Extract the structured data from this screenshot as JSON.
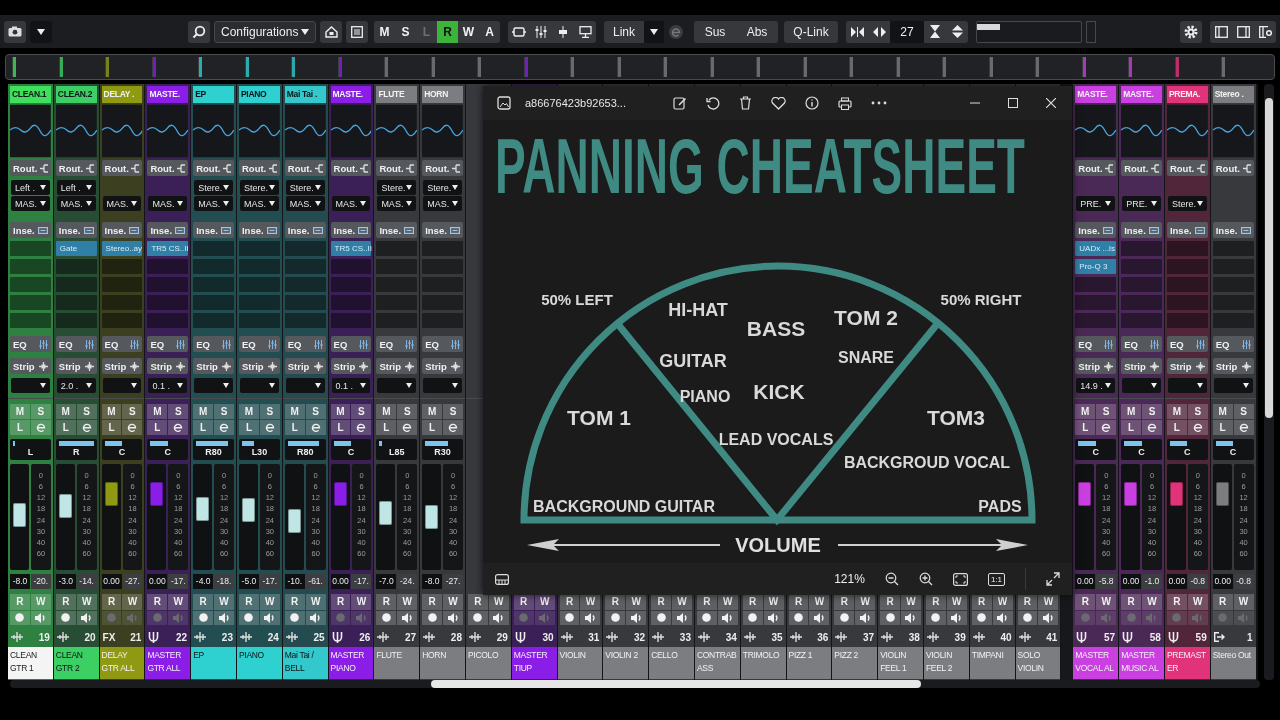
{
  "toolbar": {
    "configurations": "Configurations",
    "modes": [
      {
        "label": "M",
        "on": false,
        "disabled": false
      },
      {
        "label": "S",
        "on": false,
        "disabled": false
      },
      {
        "label": "L",
        "on": false,
        "disabled": true
      },
      {
        "label": "R",
        "on": true,
        "disabled": false
      },
      {
        "label": "W",
        "on": false,
        "disabled": false
      },
      {
        "label": "A",
        "on": false,
        "disabled": false
      }
    ],
    "link": "Link",
    "sus": "Sus",
    "abs": "Abs",
    "qlink": "Q-Link",
    "value": "27",
    "meter": {
      "level": 0.22
    }
  },
  "channels": [
    {
      "header": "CLEAN.1",
      "color": "#3ee05c",
      "selected": true,
      "kind": "audio",
      "rout": "Rout.",
      "input": "Left .",
      "output": "MAS.",
      "ins": "Inse.",
      "eq": "EQ",
      "strip": "Strip",
      "buttons": [
        "M",
        "S",
        "L"
      ],
      "pan": {
        "label": "L",
        "level": 0
      },
      "scale": [
        "0",
        "6",
        "12",
        "18",
        "24",
        "30",
        "40",
        "60"
      ],
      "fader": {
        "level": 0.52
      },
      "volume": "-8.0",
      "peak": "-20.",
      "rw": [
        "R",
        "W"
      ],
      "rec_enabled": true,
      "number": "19",
      "name": "CLEAN GTR 1"
    },
    {
      "header": "CLEAN.2",
      "color": "#3ccf64",
      "selected": false,
      "kind": "audio",
      "rout": "Rout.",
      "input": "Left .",
      "output": "MAS.",
      "ins": "Inse.",
      "inserts": [
        "Gate"
      ],
      "eq": "EQ",
      "strip": "Strip",
      "strip_value": "2.0 .",
      "buttons": [
        "M",
        "S",
        "L"
      ],
      "pan": {
        "label": "R",
        "level": 1
      },
      "scale": [
        "0",
        "6",
        "12",
        "18",
        "24",
        "30",
        "40",
        "60"
      ],
      "fader": {
        "level": 0.64
      },
      "volume": "-3.0",
      "peak": "-14.",
      "rw": [
        "R",
        "W"
      ],
      "rec_enabled": true,
      "number": "20",
      "name": "CLEAN GTR 2"
    },
    {
      "header": "DELAY .",
      "color": "#8f9a12",
      "selected": false,
      "kind": "fx",
      "type_label": "FX",
      "rout": "Rout.",
      "output": "MAS.",
      "ins": "Inse.",
      "inserts": [
        "Stereo..ay"
      ],
      "eq": "EQ",
      "strip": "Strip",
      "buttons": [
        "M",
        "S",
        "L"
      ],
      "pan": {
        "label": "C",
        "level": 0.5
      },
      "scale": [
        "0",
        "6",
        "12",
        "18",
        "24",
        "30",
        "40",
        "60"
      ],
      "fader": {
        "level": 0.78
      },
      "volume": "0.00",
      "peak": "-27.",
      "rw": [
        "R",
        "W"
      ],
      "rec_enabled": false,
      "number": "21",
      "name": "DELAY GTR ALL"
    },
    {
      "header": "MASTE.",
      "color": "#8a1ee6",
      "selected": false,
      "kind": "group",
      "rout": "Rout.",
      "output": "MAS.",
      "ins": "Inse.",
      "inserts": [
        "TR5 CS..II"
      ],
      "eq": "EQ",
      "strip": "Strip",
      "strip_value": "0.1 .",
      "buttons": [
        "M",
        "S",
        "L"
      ],
      "pan": {
        "label": "C",
        "level": 0.5
      },
      "scale": [
        "0",
        "6",
        "12",
        "18",
        "24",
        "30",
        "40",
        "60"
      ],
      "fader": {
        "level": 0.78
      },
      "volume": "0.00",
      "peak": "-17.",
      "rw": [
        "R",
        "W"
      ],
      "rec_enabled": false,
      "number": "22",
      "name": "MASTER GTR ALL"
    },
    {
      "header": "EP",
      "color": "#2ed0d0",
      "selected": false,
      "kind": "audio",
      "rout": "Rout.",
      "input": "Stere.",
      "output": "MAS.",
      "ins": "Inse.",
      "eq": "EQ",
      "strip": "Strip",
      "buttons": [
        "M",
        "S",
        "L"
      ],
      "pan": {
        "label": "R80",
        "level": 0.9
      },
      "scale": [
        "0",
        "6",
        "12",
        "18",
        "24",
        "30",
        "40",
        "60"
      ],
      "fader": {
        "level": 0.6
      },
      "volume": "-4.0",
      "peak": "-18.",
      "rw": [
        "R",
        "W"
      ],
      "rec_enabled": true,
      "number": "23",
      "name": "EP"
    },
    {
      "header": "PIANO",
      "color": "#2ed0d0",
      "selected": false,
      "kind": "audio",
      "rout": "Rout.",
      "input": "Stere.",
      "output": "MAS.",
      "ins": "Inse.",
      "eq": "EQ",
      "strip": "Strip",
      "buttons": [
        "M",
        "S",
        "L"
      ],
      "pan": {
        "label": "L30",
        "level": 0.35
      },
      "scale": [
        "0",
        "6",
        "12",
        "18",
        "24",
        "30",
        "40",
        "60"
      ],
      "fader": {
        "level": 0.58
      },
      "volume": "-5.0",
      "peak": "-17.",
      "rw": [
        "R",
        "W"
      ],
      "rec_enabled": true,
      "number": "24",
      "name": "PIANO"
    },
    {
      "header": "Mai Tai .",
      "color": "#32c8cc",
      "selected": false,
      "kind": "audio",
      "rout": "Rout.",
      "input": "Stere.",
      "output": "MAS.",
      "ins": "Inse.",
      "eq": "EQ",
      "strip": "Strip",
      "buttons": [
        "M",
        "S",
        "L"
      ],
      "pan": {
        "label": "R80",
        "level": 0.9
      },
      "scale": [
        "0",
        "6",
        "12",
        "18",
        "24",
        "30",
        "40",
        "60"
      ],
      "fader": {
        "level": 0.45
      },
      "volume": "-10.",
      "peak": "-61.",
      "rw": [
        "R",
        "W"
      ],
      "rec_enabled": true,
      "number": "25",
      "name": "Mai Tai / BELL"
    },
    {
      "header": "MASTE.",
      "color": "#8a1ee6",
      "selected": false,
      "kind": "group",
      "rout": "Rout.",
      "output": "MAS.",
      "ins": "Inse.",
      "inserts": [
        "TR5 CS..II"
      ],
      "eq": "EQ",
      "strip": "Strip",
      "strip_value": "0.1 .",
      "buttons": [
        "M",
        "S",
        "L"
      ],
      "pan": {
        "label": "C",
        "level": 0.5
      },
      "scale": [
        "0",
        "6",
        "12",
        "18",
        "24",
        "30",
        "40",
        "60"
      ],
      "fader": {
        "level": 0.78
      },
      "volume": "0.00",
      "peak": "-17.",
      "rw": [
        "R",
        "W"
      ],
      "rec_enabled": false,
      "number": "26",
      "name": "MASTER PIANO"
    },
    {
      "header": "FLUTE",
      "color": "#7b7d80",
      "selected": false,
      "kind": "audio",
      "rout": "Rout.",
      "input": "Stere.",
      "output": "MAS.",
      "ins": "Inse.",
      "eq": "EQ",
      "strip": "Strip",
      "buttons": [
        "M",
        "S",
        "L"
      ],
      "pan": {
        "label": "L85",
        "level": 0.08
      },
      "scale": [
        "0",
        "6",
        "12",
        "18",
        "24",
        "30",
        "40",
        "60"
      ],
      "fader": {
        "level": 0.55
      },
      "volume": "-7.0",
      "peak": "-24.",
      "rw": [
        "R",
        "W"
      ],
      "rec_enabled": true,
      "number": "27",
      "name": "FLUTE"
    },
    {
      "header": "HORN",
      "color": "#7b7d80",
      "selected": false,
      "kind": "audio",
      "rout": "Rout.",
      "input": "Stere.",
      "output": "MAS.",
      "ins": "Inse.",
      "eq": "EQ",
      "strip": "Strip",
      "buttons": [
        "M",
        "S",
        "L"
      ],
      "pan": {
        "label": "R30",
        "level": 0.65
      },
      "scale": [
        "0",
        "6",
        "12",
        "18",
        "24",
        "30",
        "40",
        "60"
      ],
      "fader": {
        "level": 0.5
      },
      "volume": "-8.0",
      "peak": "-27.",
      "rw": [
        "R",
        "W"
      ],
      "rec_enabled": true,
      "number": "28",
      "name": "HORN"
    },
    {
      "color": "#7b7d80",
      "selected": false,
      "kind": "audio",
      "rw": [
        "R",
        "W"
      ],
      "rec_enabled": true,
      "number": "29",
      "name": "PICOLO"
    },
    {
      "color": "#8a1ee6",
      "selected": false,
      "kind": "group",
      "rw": [
        "R",
        "W"
      ],
      "rec_enabled": false,
      "number": "30",
      "name": "MASTER TIUP"
    },
    {
      "color": "#7b7d80",
      "selected": false,
      "kind": "audio",
      "rw": [
        "R",
        "W"
      ],
      "rec_enabled": true,
      "number": "31",
      "name": "VIOLIN"
    },
    {
      "color": "#7b7d80",
      "selected": false,
      "kind": "audio",
      "rw": [
        "R",
        "W"
      ],
      "rec_enabled": true,
      "number": "32",
      "name": "VIOLIN 2"
    },
    {
      "color": "#7b7d80",
      "selected": false,
      "kind": "audio",
      "rw": [
        "R",
        "W"
      ],
      "rec_enabled": true,
      "number": "33",
      "name": "CELLO"
    },
    {
      "color": "#7b7d80",
      "selected": false,
      "kind": "audio",
      "rw": [
        "R",
        "W"
      ],
      "rec_enabled": true,
      "number": "34",
      "name": "CONTRABASS"
    },
    {
      "color": "#7b7d80",
      "selected": false,
      "kind": "audio",
      "rw": [
        "R",
        "W"
      ],
      "rec_enabled": true,
      "number": "35",
      "name": "TRIMOLO"
    },
    {
      "color": "#7b7d80",
      "selected": false,
      "kind": "audio",
      "rw": [
        "R",
        "W"
      ],
      "rec_enabled": true,
      "number": "36",
      "name": "PIZZ 1"
    },
    {
      "color": "#7b7d80",
      "selected": false,
      "kind": "audio",
      "rw": [
        "R",
        "W"
      ],
      "rec_enabled": true,
      "number": "37",
      "name": "PIZZ 2"
    },
    {
      "color": "#7b7d80",
      "selected": false,
      "kind": "audio",
      "rw": [
        "R",
        "W"
      ],
      "rec_enabled": true,
      "number": "38",
      "name": "VIOLIN FEEL 1"
    },
    {
      "color": "#7b7d80",
      "selected": false,
      "kind": "audio",
      "rw": [
        "R",
        "W"
      ],
      "rec_enabled": true,
      "number": "39",
      "name": "VIOLIN FEEL 2"
    },
    {
      "color": "#7b7d80",
      "selected": false,
      "kind": "audio",
      "rw": [
        "R",
        "W"
      ],
      "rec_enabled": true,
      "number": "40",
      "name": "TIMPANI"
    },
    {
      "color": "#7b7d80",
      "selected": false,
      "kind": "audio",
      "rw": [
        "R",
        "W"
      ],
      "rec_enabled": true,
      "number": "41",
      "name": "SOLO VIOLIN"
    },
    {
      "header": "MASTE.",
      "color": "#c93fe0",
      "selected": false,
      "kind": "group",
      "rout": "Rout.",
      "output": "PRE.",
      "ins": "Inse.",
      "inserts": [
        "UADx ...ls",
        "Pro-Q 3"
      ],
      "eq": "EQ",
      "strip": "Strip",
      "strip_value": "14.9 .",
      "buttons": [
        "M",
        "S",
        "L"
      ],
      "pan": {
        "label": "C",
        "level": 0.5
      },
      "scale": [
        "0",
        "6",
        "12",
        "18",
        "24",
        "30",
        "40",
        "60"
      ],
      "fader": {
        "level": 0.78
      },
      "volume": "0.00",
      "peak": "-5.8",
      "rw": [
        "R",
        "W"
      ],
      "rec_enabled": false,
      "number": "57",
      "name": "MASTER VOCAL AL"
    },
    {
      "header": "MASTE.",
      "color": "#c93fe0",
      "selected": false,
      "kind": "group",
      "rout": "Rout.",
      "output": "PRE.",
      "ins": "Inse.",
      "eq": "EQ",
      "strip": "Strip",
      "buttons": [
        "M",
        "S",
        "L"
      ],
      "pan": {
        "label": "C",
        "level": 0.5
      },
      "scale": [
        "0",
        "6",
        "12",
        "18",
        "24",
        "30",
        "40",
        "60"
      ],
      "fader": {
        "level": 0.78
      },
      "volume": "0.00",
      "peak": "-1.0",
      "rw": [
        "R",
        "W"
      ],
      "rec_enabled": false,
      "number": "58",
      "name": "MASTER MUSIC AL"
    },
    {
      "header": "PREMA.",
      "color": "#e0337a",
      "selected": false,
      "kind": "group",
      "rout": "Rout.",
      "output": "Stere.",
      "ins": "Inse.",
      "eq": "EQ",
      "strip": "Strip",
      "buttons": [
        "M",
        "S",
        "L"
      ],
      "pan": {
        "label": "C",
        "level": 0.5
      },
      "scale": [
        "0",
        "6",
        "12",
        "18",
        "24",
        "30",
        "40",
        "60"
      ],
      "fader": {
        "level": 0.78
      },
      "volume": "0.00",
      "peak": "-0.8",
      "rw": [
        "R",
        "W"
      ],
      "rec_enabled": false,
      "number": "59",
      "name": "PREMASTER"
    },
    {
      "header": "Stereo .",
      "color": "#7b7d80",
      "selected": false,
      "kind": "output",
      "rout": "Rout.",
      "ins": "Inse.",
      "eq": "EQ",
      "strip": "Strip",
      "buttons": [
        "M",
        "S",
        "L"
      ],
      "pan": {
        "label": "C",
        "level": 0.5
      },
      "scale": [
        "0",
        "6",
        "12",
        "18",
        "24",
        "30",
        "40",
        "60"
      ],
      "fader": {
        "level": 0.78
      },
      "volume": "0.00",
      "peak": "-0.8",
      "rw": [
        "R",
        "W"
      ],
      "rec_enabled": false,
      "number": "1",
      "name": "Stereo Out"
    }
  ],
  "viewer": {
    "title": "a86676423b92653...",
    "zoom": "121%",
    "actual_size": "1:1",
    "image": {
      "title": "PANNING CHEATSHEET",
      "axis_label": "VOLUME",
      "labels": [
        "50% LEFT",
        "HI-HAT",
        "BASS",
        "TOM 2",
        "50% RIGHT",
        "GUITAR",
        "SNARE",
        "PIANO",
        "KICK",
        "TOM 1",
        "LEAD VOCALS",
        "TOM3",
        "BACKGROUD VOCAL",
        "BACKGROUND GUITAR",
        "PADS"
      ]
    }
  }
}
